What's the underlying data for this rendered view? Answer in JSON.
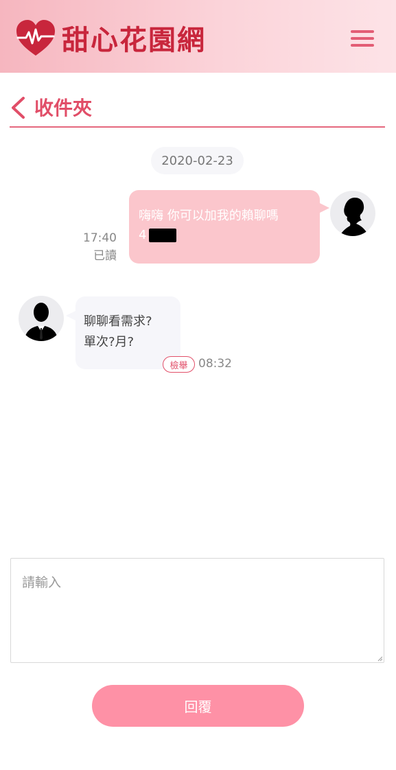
{
  "header": {
    "logo_text": "甜心花園網",
    "logo_icon": "heart-pulse-icon",
    "menu_icon": "hamburger-menu-icon"
  },
  "title_row": {
    "back_icon": "chevron-left-icon",
    "title": "收件夾"
  },
  "conversation": {
    "date": "2020-02-23",
    "messages": [
      {
        "direction": "outgoing",
        "avatar": "female-silhouette-avatar",
        "line1": "嗨嗨 你可以加我的賴聊嗎",
        "line2": "4",
        "time": "17:40",
        "status": "已讀"
      },
      {
        "direction": "incoming",
        "avatar": "male-silhouette-avatar",
        "line1": "聊聊看需求?",
        "line2": "單次?月?",
        "report_label": "檢舉",
        "time": "08:32"
      }
    ]
  },
  "reply": {
    "placeholder": "請輸入",
    "button_label": "回覆"
  },
  "colors": {
    "accent": "#e14e68",
    "outgoing_bubble": "#fbc6cc",
    "incoming_bubble": "#f6f6fa",
    "reply_button": "#fe91a6"
  }
}
